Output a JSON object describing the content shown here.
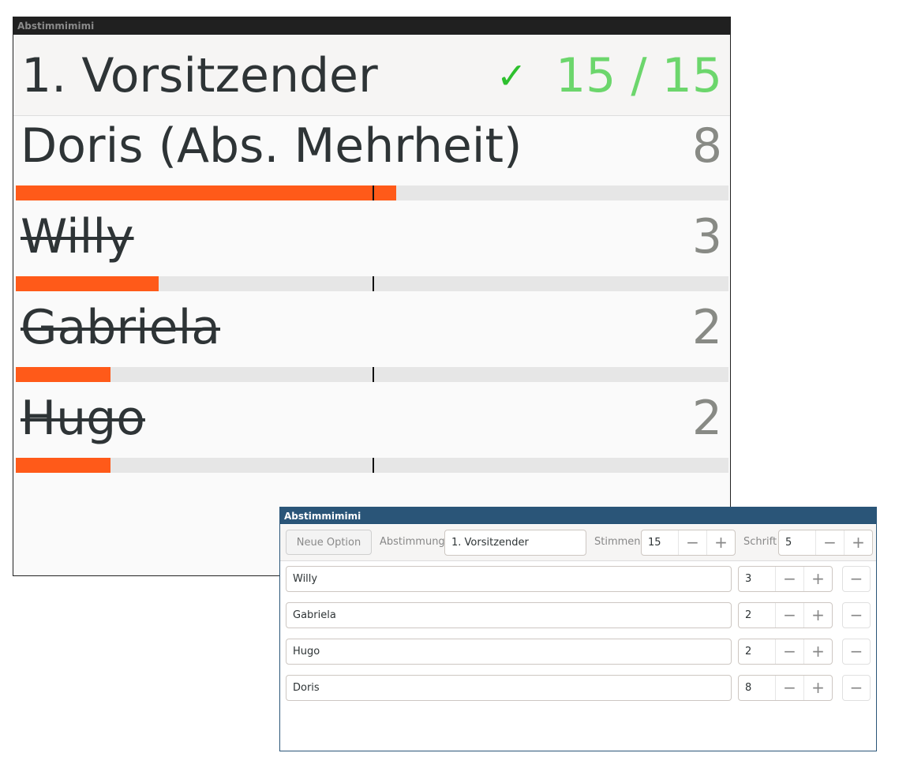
{
  "display": {
    "window_title": "Abstimmimimi",
    "title": "1. Vorsitzender",
    "status_icon": "check-icon",
    "count": "15 / 15",
    "colors": {
      "bar": "#ff5a19",
      "count": "#6cd66c",
      "check": "#2ec02e"
    },
    "total": 15,
    "rows": [
      {
        "name": "Doris (Abs. Mehrheit)",
        "votes": "8",
        "value": 8,
        "struck": false
      },
      {
        "name": "Willy",
        "votes": "3",
        "value": 3,
        "struck": true
      },
      {
        "name": "Gabriela",
        "votes": "2",
        "value": 2,
        "struck": true
      },
      {
        "name": "Hugo",
        "votes": "2",
        "value": 2,
        "struck": true
      }
    ]
  },
  "control": {
    "window_title": "Abstimmimimi",
    "new_option": "Neue Option",
    "abstimmung_label": "Abstimmung",
    "abstimmung_value": "1. Vorsitzender",
    "stimmen_label": "Stimmen",
    "stimmen_value": "15",
    "schrift_label": "Schrift",
    "schrift_value": "5",
    "minus": "−",
    "plus": "+",
    "options": [
      {
        "name": "Willy",
        "votes": "3"
      },
      {
        "name": "Gabriela",
        "votes": "2"
      },
      {
        "name": "Hugo",
        "votes": "2"
      },
      {
        "name": "Doris",
        "votes": "8"
      }
    ]
  }
}
